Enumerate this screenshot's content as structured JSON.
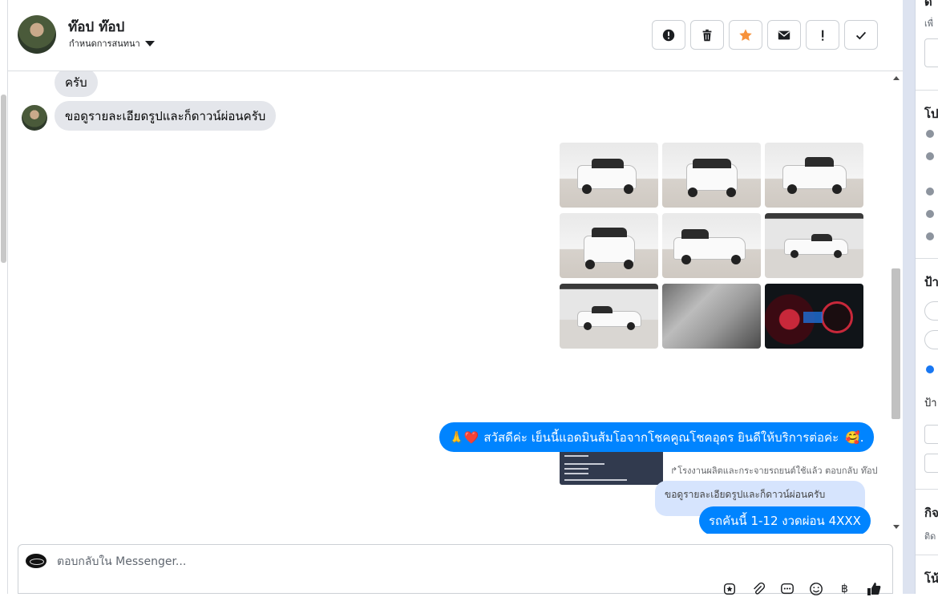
{
  "header": {
    "contact_name": "ท๊อป ท๊อป",
    "subtitle": "กำหนดการสนทนา"
  },
  "actions": [
    {
      "name": "report-icon",
      "label": "!"
    },
    {
      "name": "trash-icon",
      "label": "delete"
    },
    {
      "name": "star-icon",
      "label": "star",
      "color": "#f7923b"
    },
    {
      "name": "mail-icon",
      "label": "mail"
    },
    {
      "name": "exclamation-icon",
      "label": "!"
    },
    {
      "name": "check-icon",
      "label": "done"
    }
  ],
  "messages": {
    "incoming_1": "ครับ",
    "incoming_2": "ขอดูรายละเอียดรูปและก็ดาวน์ผ่อนครับ",
    "outgoing_greeting_prefix": "🙏❤️",
    "outgoing_greeting": "สวัสดีค่ะ เย็นนี้แอดมินส้มโอจากโชคคูณโชคอุดร ยินดีให้บริการต่อค่ะ",
    "outgoing_greeting_suffix": "🥰.",
    "reply_meta": "โรงงานผลิตและกระจายรถยนต์ใช้แล้ว ตอบกลับ ท๊อป",
    "reply_quote": "ขอดูรายละเอียดรูปและก็ดาวน์ผ่อนครับ",
    "outgoing_reply": "รถคันนี้ 1-12 งวดผ่อน 4XXX"
  },
  "composer": {
    "placeholder": "ตอบกลับใน Messenger..."
  },
  "composer_tools": [
    "saved-reply-icon",
    "attach-icon",
    "more-icon",
    "emoji-icon",
    "baht-icon",
    "like-icon"
  ],
  "sidebar": {
    "fragments": [
      "ดี",
      "เพื่",
      "โป",
      "ป้า",
      "ป้า",
      "กิจ",
      "ติด",
      "โน้"
    ]
  },
  "colors": {
    "accent": "#0084ff",
    "bubble_in": "#e4e6eb",
    "quote_bg": "#d6e4fd"
  }
}
